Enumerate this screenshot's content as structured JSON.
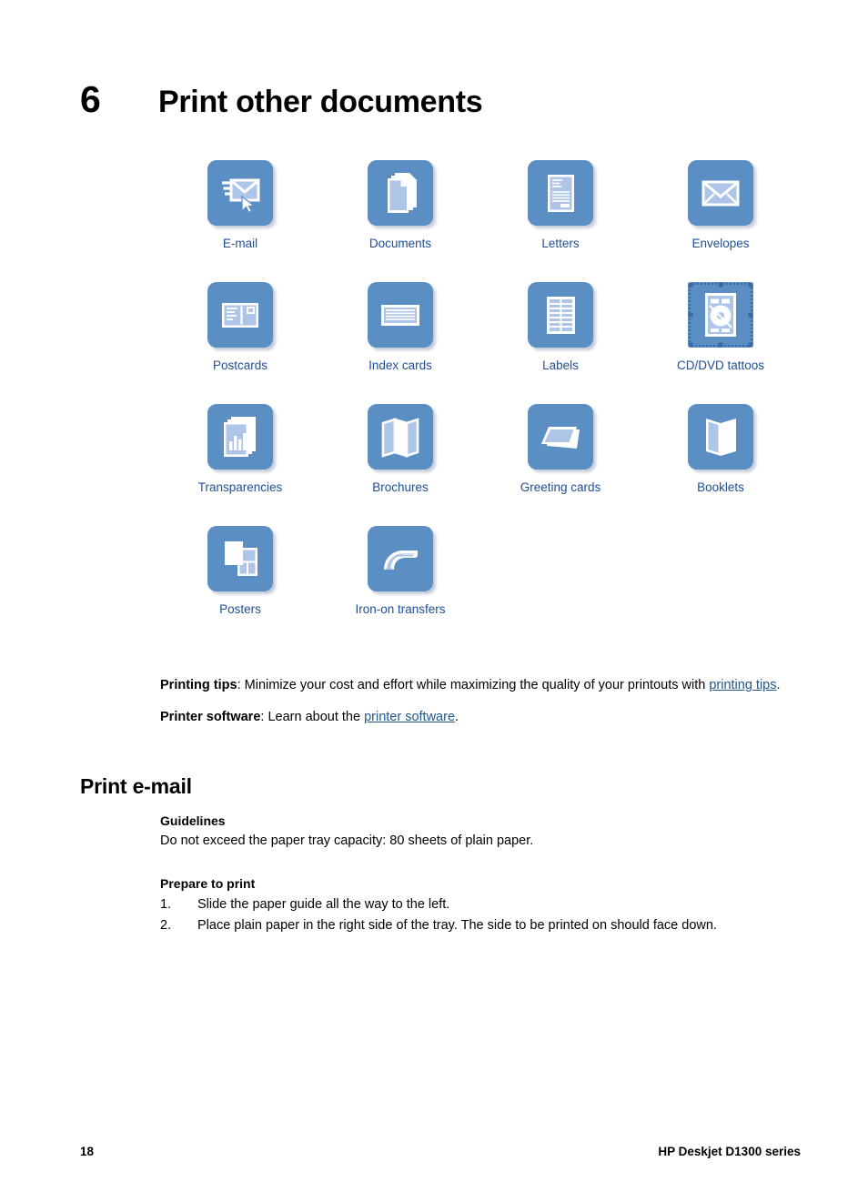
{
  "chapter": {
    "number": "6",
    "title": "Print other documents"
  },
  "icon_grid": {
    "rows": [
      [
        {
          "label": "E-mail",
          "icon": "email-icon"
        },
        {
          "label": "Documents",
          "icon": "documents-icon"
        },
        {
          "label": "Letters",
          "icon": "letters-icon"
        },
        {
          "label": "Envelopes",
          "icon": "envelopes-icon"
        }
      ],
      [
        {
          "label": "Postcards",
          "icon": "postcards-icon"
        },
        {
          "label": "Index cards",
          "icon": "index-cards-icon"
        },
        {
          "label": "Labels",
          "icon": "labels-icon"
        },
        {
          "label": "CD/DVD tattoos",
          "icon": "cd-dvd-tattoos-icon"
        }
      ],
      [
        {
          "label": "Transparencies",
          "icon": "transparencies-icon"
        },
        {
          "label": "Brochures",
          "icon": "brochures-icon"
        },
        {
          "label": "Greeting cards",
          "icon": "greeting-cards-icon"
        },
        {
          "label": "Booklets",
          "icon": "booklets-icon"
        }
      ],
      [
        {
          "label": "Posters",
          "icon": "posters-icon"
        },
        {
          "label": "Iron-on transfers",
          "icon": "iron-on-transfers-icon"
        }
      ]
    ]
  },
  "intro": {
    "tips_label": "Printing tips",
    "tips_text_1": ": Minimize your cost and effort while maximizing the quality of your printouts with ",
    "tips_link": "printing tips",
    "tips_text_2": ".",
    "software_label": "Printer software",
    "software_text_1": ": Learn about the ",
    "software_link": "printer software",
    "software_text_2": "."
  },
  "section": {
    "title": "Print e-mail",
    "guidelines_head": "Guidelines",
    "guidelines_text": "Do not exceed the paper tray capacity: 80 sheets of plain paper.",
    "prepare_head": "Prepare to print",
    "steps": [
      "Slide the paper guide all the way to the left.",
      "Place plain paper in the right side of the tray. The side to be printed on should face down."
    ]
  },
  "footer": {
    "page_number": "18",
    "product": "HP Deskjet D1300 series"
  },
  "colors": {
    "icon_tile": "#5b8fc4",
    "icon_art_light": "#aec5e8",
    "label_link": "#1f4e96",
    "inline_link": "#21578a"
  }
}
